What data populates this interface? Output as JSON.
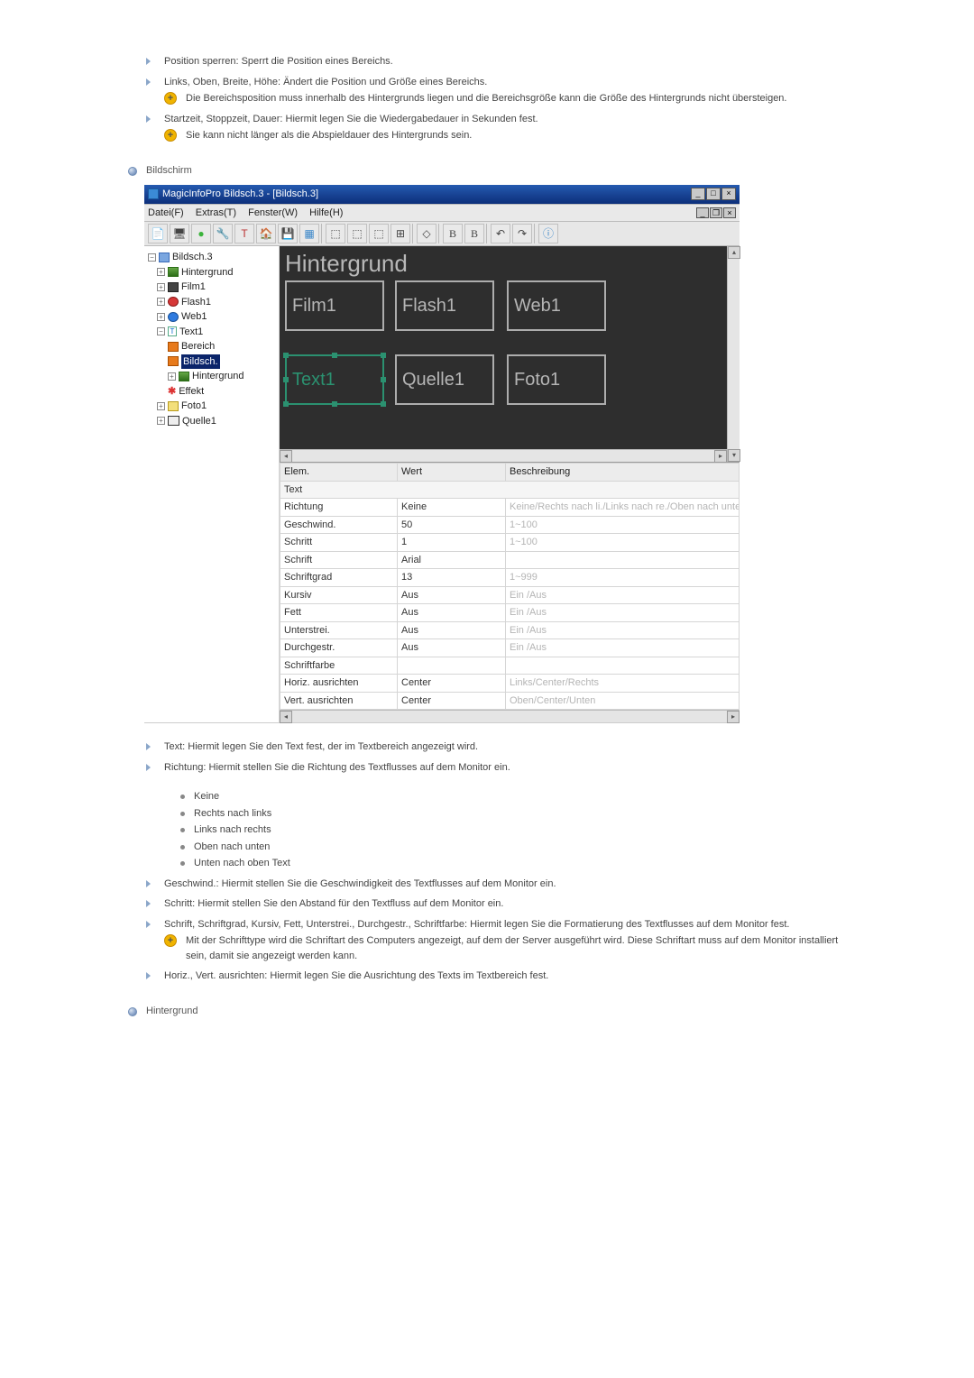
{
  "intro_bullets": [
    {
      "text": "Position sperren: Sperrt die Position eines Bereichs."
    },
    {
      "text": "Links, Oben, Breite, Höhe: Ändert die Position und Größe eines Bereichs.",
      "note": "Die Bereichsposition muss innerhalb des Hintergrunds liegen und die Bereichsgröße kann die Größe des Hintergrunds nicht übersteigen."
    },
    {
      "text": "Startzeit, Stoppzeit, Dauer: Hiermit legen Sie die Wiedergabedauer in Sekunden fest.",
      "note": "Sie kann nicht länger als die Abspieldauer des Hintergrunds sein."
    }
  ],
  "section_bildschirm": "Bildschirm",
  "screenshot": {
    "title": "MagicInfoPro Bildsch.3 - [Bildsch.3]",
    "menus": [
      "Datei(F)",
      "Extras(T)",
      "Fenster(W)",
      "Hilfe(H)"
    ],
    "tree": {
      "root": "Bildsch.3",
      "hintergrund": "Hintergrund",
      "film1": "Film1",
      "flash1": "Flash1",
      "web1": "Web1",
      "text1": "Text1",
      "bereich": "Bereich",
      "bildsch": "Bildsch.",
      "bg_inner": "Hintergrund",
      "effekt": "Effekt",
      "foto1": "Foto1",
      "quelle1": "Quelle1"
    },
    "canvas": {
      "bg_label": "Hintergrund",
      "tiles": {
        "film1": "Film1",
        "flash1": "Flash1",
        "web1": "Web1",
        "text1": "Text1",
        "quelle1": "Quelle1",
        "foto1": "Foto1"
      }
    },
    "props": {
      "headers": {
        "elem": "Elem.",
        "wert": "Wert",
        "besch": "Beschreibung"
      },
      "group": "Text",
      "rows": [
        {
          "elem": "Richtung",
          "wert": "Keine",
          "besch": "Keine/Rechts nach li./Links nach re./Oben nach unten/Obe"
        },
        {
          "elem": "Geschwind.",
          "wert": "50",
          "besch": "1~100"
        },
        {
          "elem": "Schritt",
          "wert": "1",
          "besch": "1~100"
        },
        {
          "elem": "Schrift",
          "wert": "Arial",
          "besch": ""
        },
        {
          "elem": "Schriftgrad",
          "wert": "13",
          "besch": "1~999"
        },
        {
          "elem": "Kursiv",
          "wert": "Aus",
          "besch": "Ein /Aus"
        },
        {
          "elem": "Fett",
          "wert": "Aus",
          "besch": "Ein /Aus"
        },
        {
          "elem": "Unterstrei.",
          "wert": "Aus",
          "besch": "Ein /Aus"
        },
        {
          "elem": "Durchgestr.",
          "wert": "Aus",
          "besch": "Ein /Aus"
        },
        {
          "elem": "Schriftfarbe",
          "wert": "",
          "besch": ""
        },
        {
          "elem": "Horiz. ausrichten",
          "wert": "Center",
          "besch": "Links/Center/Rechts"
        },
        {
          "elem": "Vert. ausrichten",
          "wert": "Center",
          "besch": "Oben/Center/Unten"
        }
      ]
    }
  },
  "post_bullets": {
    "text": "Text: Hiermit legen Sie den Text fest, der im Textbereich angezeigt wird.",
    "richtung": "Richtung: Hiermit stellen Sie die Richtung des Textflusses auf dem Monitor ein.",
    "richtung_opts": [
      "Keine",
      "Rechts nach links",
      "Links nach rechts",
      "Oben nach unten",
      "Unten nach oben Text"
    ],
    "geschwind": "Geschwind.: Hiermit stellen Sie die Geschwindigkeit des Textflusses auf dem Monitor ein.",
    "schritt": "Schritt: Hiermit stellen Sie den Abstand für den Textfluss auf dem Monitor ein.",
    "schriften": "Schrift, Schriftgrad, Kursiv, Fett, Unterstrei., Durchgestr., Schriftfarbe: Hiermit legen Sie die Formatierung des Textflusses auf dem Monitor fest.",
    "schriften_note": "Mit der Schrifttype wird die Schriftart des Computers angezeigt, auf dem der Server ausgeführt wird. Diese Schriftart muss auf dem Monitor installiert sein, damit sie angezeigt werden kann.",
    "horizvert": "Horiz., Vert. ausrichten: Hiermit legen Sie die Ausrichtung des Texts im Textbereich fest."
  },
  "section_hintergrund": "Hintergrund"
}
